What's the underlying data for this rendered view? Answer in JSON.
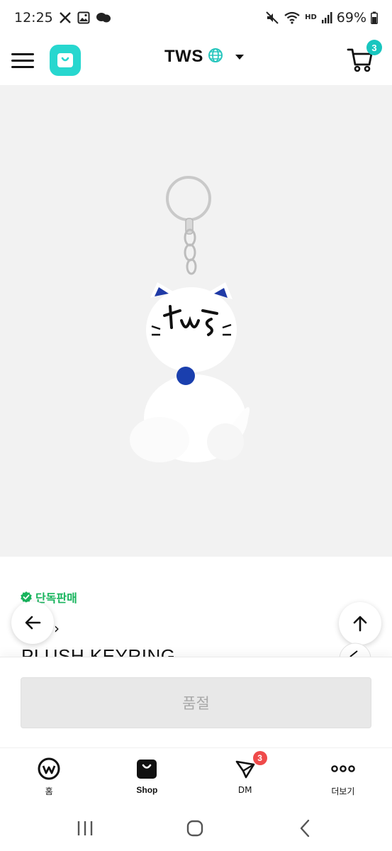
{
  "status_bar": {
    "time": "12:25",
    "battery": "69%",
    "network_label": "HD"
  },
  "header": {
    "artist_name": "TWS",
    "cart_count": "3",
    "accent_color": "#27d7cf"
  },
  "product": {
    "exclusive_label": "단독판매",
    "title": "PLUSH KEYRING",
    "breadcrumb_chevron": "›",
    "image": "plush-cat-keyring"
  },
  "buy_bar": {
    "sold_out_label": "품절"
  },
  "bottom_nav": {
    "items": [
      {
        "label": "홈",
        "icon": "weverse-home-icon"
      },
      {
        "label": "Shop",
        "icon": "shop-bag-icon"
      },
      {
        "label": "DM",
        "icon": "dm-icon",
        "badge": "3"
      },
      {
        "label": "더보기",
        "icon": "more-icon"
      }
    ]
  },
  "colors": {
    "exclusive_green": "#18b45d",
    "badge_red": "#ef4a4a",
    "cart_badge_teal": "#19c6bf",
    "sold_out_bg": "#e8e8e8"
  }
}
